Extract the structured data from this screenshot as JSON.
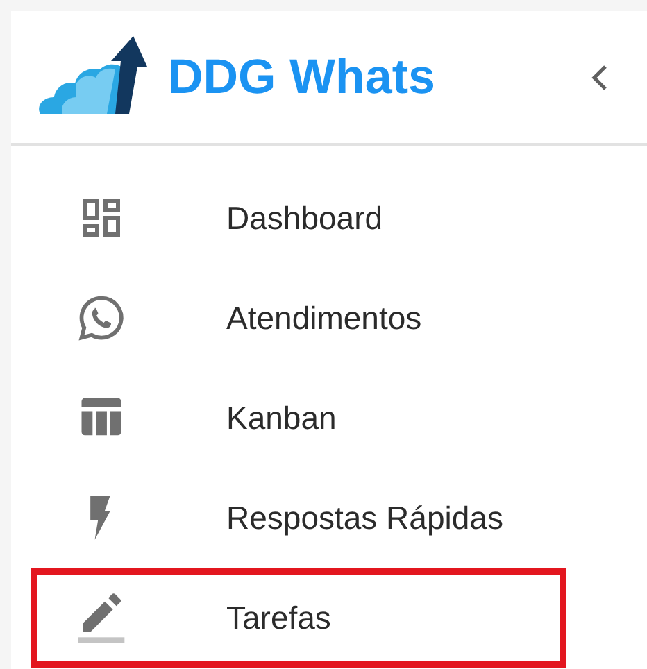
{
  "header": {
    "title": "DDG Whats"
  },
  "items": [
    {
      "label": "Dashboard",
      "highlighted": false
    },
    {
      "label": "Atendimentos",
      "highlighted": false
    },
    {
      "label": "Kanban",
      "highlighted": false
    },
    {
      "label": "Respostas Rápidas",
      "highlighted": false
    },
    {
      "label": "Tarefas",
      "highlighted": true
    }
  ]
}
